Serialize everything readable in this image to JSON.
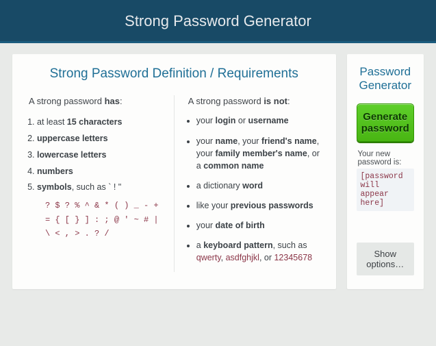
{
  "header": {
    "title": "Strong Password Generator"
  },
  "definition": {
    "title": "Strong Password Definition / Requirements",
    "has_lead_pre": "A strong password ",
    "has_lead_bold": "has",
    "has_lead_post": ":",
    "not_lead_pre": "A strong password ",
    "not_lead_bold": "is not",
    "not_lead_post": ":",
    "has": {
      "i1_pre": "at least ",
      "i1_b": "15 characters",
      "i2_b": "uppercase letters",
      "i3_b": "lowercase letters",
      "i4_b": "numbers",
      "i5_b": "symbols",
      "i5_post": ", such as ` ! \"",
      "symbols_block": "? $ ? % ^ & * ( ) _ - + = { [ } ] : ; @ ' ~ # | \\ < , > . ? /"
    },
    "not": {
      "i1_pre": "your ",
      "i1_b1": "login",
      "i1_mid": " or ",
      "i1_b2": "username",
      "i2_pre": "your ",
      "i2_b1": "name",
      "i2_m1": ", your ",
      "i2_b2": "friend's name",
      "i2_m2": ", your ",
      "i2_b3": "family member's name",
      "i2_m3": ", or a ",
      "i2_b4": "common name",
      "i3_pre": "a dictionary ",
      "i3_b": "word",
      "i4_pre": "like your ",
      "i4_b": "previous passwords",
      "i5_pre": "your ",
      "i5_b": "date of birth",
      "i6_pre": "a ",
      "i6_b": "keyboard pattern",
      "i6_mid": ", such as ",
      "i6_e1": "qwerty",
      "i6_sep1": ", ",
      "i6_e2": "asdfghjkl",
      "i6_sep2": ", or ",
      "i6_e3": "12345678"
    }
  },
  "generator": {
    "title": "Password Generator",
    "button_label": "Generate password",
    "output_label": "Your new password is:",
    "output_placeholder": "[password will appear here]",
    "show_options_label": "Show options…"
  }
}
